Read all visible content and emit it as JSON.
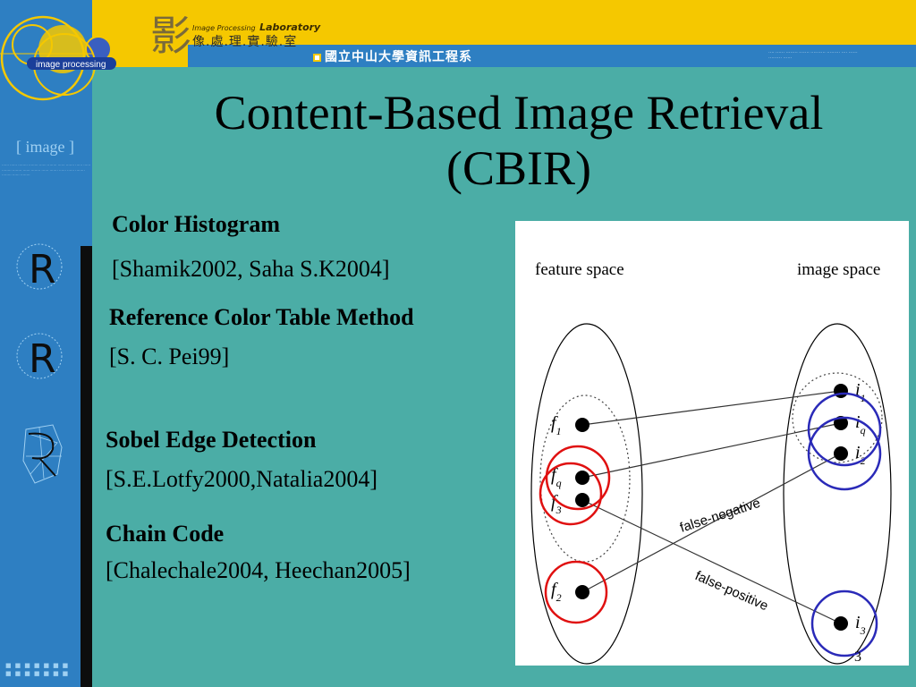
{
  "header": {
    "lab_small": "Image Processing",
    "lab_name": "Laboratory",
    "lab_chinese": "像.處.理.實.驗.室",
    "department": "國立中山大學資訊工程系",
    "logo_text": "image processing",
    "calligraphy": "影"
  },
  "sidebar": {
    "image_label": "[ image ]",
    "squares": "■■■■■■■ ■■■■■■■"
  },
  "slide": {
    "title_line1": "Content-Based Image Retrieval",
    "title_line2": "(CBIR)",
    "page_number": "3"
  },
  "methods": [
    {
      "name": "Color Histogram",
      "ref": "[Shamik2002, Saha S.K2004]"
    },
    {
      "name": "Reference Color Table Method",
      "ref": "[S. C. Pei99]"
    },
    {
      "name": "Sobel Edge Detection",
      "ref": "[S.E.Lotfy2000,Natalia2004]"
    },
    {
      "name": "Chain Code",
      "ref": "[Chalechale2004, Heechan2005]"
    }
  ],
  "figure": {
    "feature_space": "feature space",
    "image_space": "image space",
    "f1": "f",
    "f1_sub": "1",
    "fq": "f",
    "fq_sub": "q",
    "f3": "f",
    "f3_sub": "3",
    "f2": "f",
    "f2_sub": "2",
    "i1": "i",
    "i1_sub": "1",
    "iq": "i",
    "iq_sub": "q",
    "i2": "i",
    "i2_sub": "2",
    "i3": "i",
    "i3_sub": "3",
    "false_negative": "false-negative",
    "false_positive": "false-positive",
    "colors": {
      "red": "#e01010",
      "blue": "#2a2ab8"
    }
  }
}
